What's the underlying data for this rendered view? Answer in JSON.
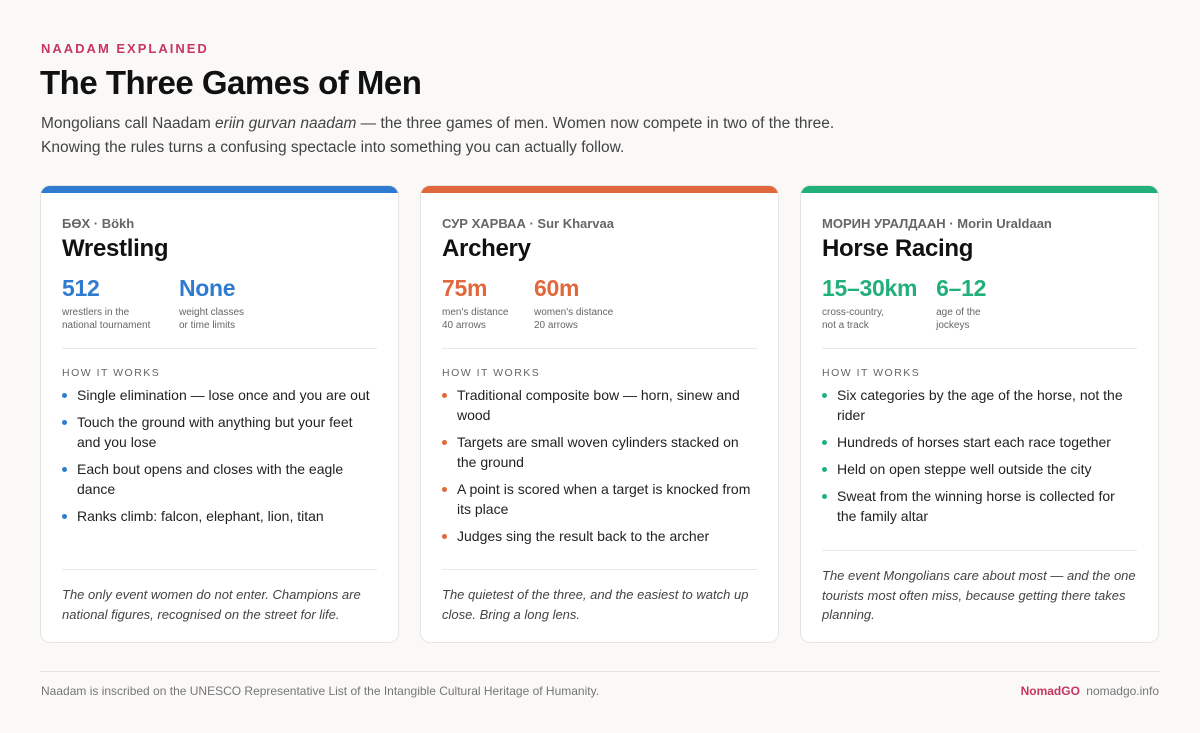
{
  "header": {
    "eyebrow": "NAADAM EXPLAINED",
    "title": "The Three Games of Men",
    "intro_line1_before": "Mongolians call Naadam ",
    "intro_line1_em": "eriin gurvan naadam",
    "intro_line1_after": " — the three games of men. Women now compete in two of the three.",
    "intro_line2": "Knowing the rules turns a confusing spectacle into something you can actually follow."
  },
  "colors": {
    "wrestling": "#2f7bd0",
    "archery": "#e0683c",
    "horse": "#22b07a",
    "accent": "#c7365f"
  },
  "cards": [
    {
      "native": "БӨХ",
      "translit": "Bökh",
      "title": "Wrestling",
      "stats": [
        {
          "value": "512",
          "label": "wrestlers in the\nnational tournament"
        },
        {
          "value": "None",
          "label": "weight classes\nor time limits"
        }
      ],
      "how_label": "HOW IT WORKS",
      "bullets": [
        "Single elimination — lose once and you are out",
        "Touch the ground with anything but your feet and you lose",
        "Each bout opens and closes with the eagle dance",
        "Ranks climb: falcon, elephant, lion, titan"
      ],
      "note": "The only event women do not enter. Champions are national figures, recognised on the street for life."
    },
    {
      "native": "СУР ХАРВАА",
      "translit": "Sur Kharvaa",
      "title": "Archery",
      "stats": [
        {
          "value": "75m",
          "label": "men's distance\n40 arrows"
        },
        {
          "value": "60m",
          "label": "women's distance\n20 arrows"
        }
      ],
      "how_label": "HOW IT WORKS",
      "bullets": [
        "Traditional composite bow — horn, sinew and wood",
        "Targets are small woven cylinders stacked on the ground",
        "A point is scored when a target is knocked from its place",
        "Judges sing the result back to the archer"
      ],
      "note": "The quietest of the three, and the easiest to watch up close. Bring a long lens."
    },
    {
      "native": "МОРИН УРАЛДААН",
      "translit": "Morin Uraldaan",
      "title": "Horse Racing",
      "stats": [
        {
          "value": "15–30km",
          "label": "cross-country,\nnot a track"
        },
        {
          "value": "6–12",
          "label": "age of the\njockeys"
        }
      ],
      "how_label": "HOW IT WORKS",
      "bullets": [
        "Six categories by the age of the horse, not the rider",
        "Hundreds of horses start each race together",
        "Held on open steppe well outside the city",
        "Sweat from the winning horse is collected for the family altar"
      ],
      "note": "The event Mongolians care about most — and the one tourists most often miss, because getting there takes planning."
    }
  ],
  "footer": {
    "text": "Naadam is inscribed on the UNESCO Representative List of the Intangible Cultural Heritage of Humanity.",
    "brand": "NomadGO",
    "site": "nomadgo.info"
  }
}
